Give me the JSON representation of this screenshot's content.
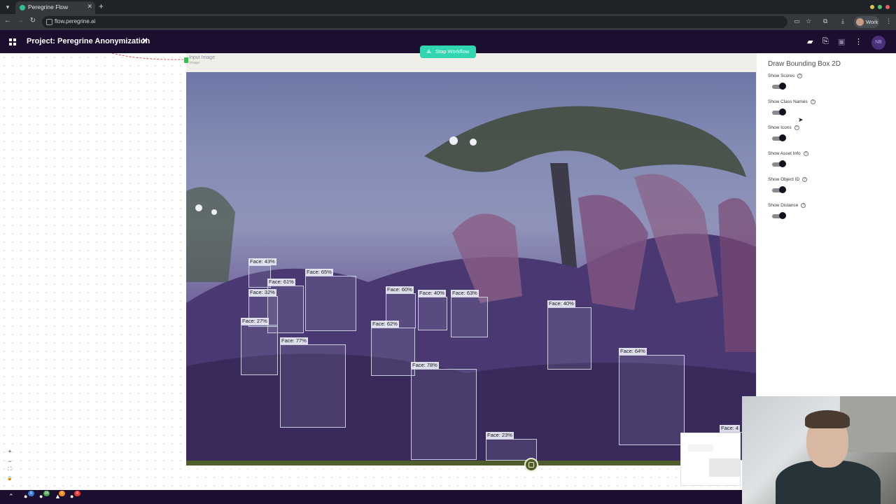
{
  "browser": {
    "tab_title": "Peregrine Flow",
    "tab_close": "✕",
    "new_tab": "+",
    "url": "flow.peregrine.ai",
    "profile_label": "Work",
    "window_dot_colors": [
      "#e5c04a",
      "#54c76e",
      "#e86257"
    ]
  },
  "app": {
    "project_title": "Project: Peregrine Anonymization",
    "avatar_initials": "NB"
  },
  "workflow": {
    "stop_label": "Stop Workflow"
  },
  "node": {
    "label": "Input Image",
    "sublabel": "Image"
  },
  "detections": [
    {
      "label": "Face: 43%"
    },
    {
      "label": "Face: 61%"
    },
    {
      "label": "Face: 65%"
    },
    {
      "label": "Face: 32%"
    },
    {
      "label": "Face: 27%"
    },
    {
      "label": "Face: 77%"
    },
    {
      "label": "Face: 60%"
    },
    {
      "label": "Face: 62%"
    },
    {
      "label": "Face: 40%"
    },
    {
      "label": "Face: 63%"
    },
    {
      "label": "Face: 78%"
    },
    {
      "label": "Face: 40%"
    },
    {
      "label": "Face: 64%"
    },
    {
      "label": "Face: 23%"
    },
    {
      "label": "Face: 4"
    }
  ],
  "panel": {
    "title": "Draw Bounding Box 2D",
    "options": [
      {
        "label": "Show Scores",
        "enabled": true
      },
      {
        "label": "Show Class Names",
        "enabled": true
      },
      {
        "label": "Show Icons",
        "enabled": true
      },
      {
        "label": "Show Asset Info",
        "enabled": true
      },
      {
        "label": "Show Object ID",
        "enabled": true
      },
      {
        "label": "Show Distance",
        "enabled": true
      }
    ]
  },
  "zoom_controls": {
    "zoom_in": "+",
    "zoom_out": "−",
    "fit": "⛶",
    "lock": "🔒"
  },
  "bottom_badges": {
    "b1": {
      "value": "0",
      "color": "#3a7bd5"
    },
    "b2": {
      "value": "35",
      "color": "#43a047"
    },
    "b3": {
      "value": "0",
      "color": "#f08a24"
    },
    "b4": {
      "value": "0",
      "color": "#e53935"
    }
  },
  "colors": {
    "brand_dark": "#1c0e2e",
    "accent": "#2fd6b0"
  }
}
